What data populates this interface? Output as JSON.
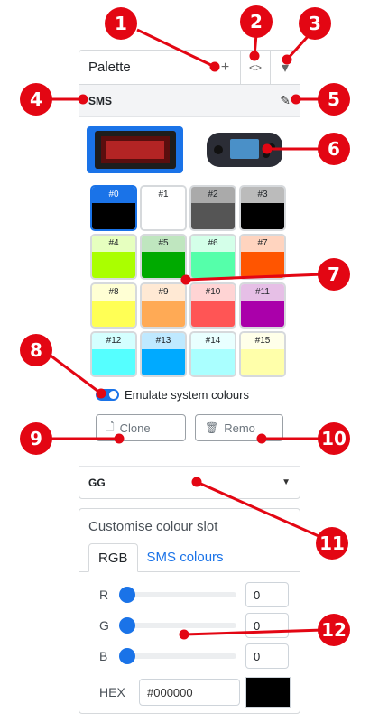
{
  "palette_panel": {
    "title": "Palette",
    "add_icon": "+",
    "code_icon": "<>",
    "menu_icon": "▾",
    "section_sms": "SMS",
    "edit_icon": "✎",
    "swatches": [
      {
        "label": "#0",
        "color": "#000000",
        "label_bg": "#1a73e8"
      },
      {
        "label": "#1",
        "color": "#ffffff",
        "label_bg": "#ffffff"
      },
      {
        "label": "#2",
        "color": "#555555",
        "label_bg": "#aaaaaa"
      },
      {
        "label": "#3",
        "color": "#000000",
        "label_bg": "#bbbbbb"
      },
      {
        "label": "#4",
        "color": "#aaff00",
        "label_bg": "#e6ffbf"
      },
      {
        "label": "#5",
        "color": "#00aa00",
        "label_bg": "#bfe6bf"
      },
      {
        "label": "#6",
        "color": "#55ffaa",
        "label_bg": "#d4ffe9"
      },
      {
        "label": "#7",
        "color": "#ff5500",
        "label_bg": "#ffd4bf"
      },
      {
        "label": "#8",
        "color": "#ffff55",
        "label_bg": "#ffffd4"
      },
      {
        "label": "#9",
        "color": "#ffaa55",
        "label_bg": "#ffe9d4"
      },
      {
        "label": "#10",
        "color": "#ff5555",
        "label_bg": "#ffd4d4"
      },
      {
        "label": "#11",
        "color": "#aa00aa",
        "label_bg": "#e6bfe6"
      },
      {
        "label": "#12",
        "color": "#55ffff",
        "label_bg": "#d4ffff"
      },
      {
        "label": "#13",
        "color": "#00aaff",
        "label_bg": "#bfe9ff"
      },
      {
        "label": "#14",
        "color": "#aaffff",
        "label_bg": "#e9ffff"
      },
      {
        "label": "#15",
        "color": "#ffffaa",
        "label_bg": "#ffffe9"
      }
    ],
    "toggle_label": "Emulate system colours",
    "clone_label": "Clone",
    "remove_label": "Remo",
    "section_gg": "GG",
    "expand_icon": "▼"
  },
  "customise_panel": {
    "title": "Customise colour slot",
    "tabs": [
      "RGB",
      "SMS colours"
    ],
    "r_label": "R",
    "r_value": "0",
    "g_label": "G",
    "g_value": "0",
    "b_label": "B",
    "b_value": "0",
    "hex_label": "HEX",
    "hex_value": "#000000",
    "hex_color": "#000000"
  },
  "callouts": [
    "1",
    "2",
    "3",
    "4",
    "5",
    "6",
    "7",
    "8",
    "9",
    "10",
    "11",
    "12"
  ],
  "accent": "#1a73e8",
  "callout_color": "#e30613"
}
